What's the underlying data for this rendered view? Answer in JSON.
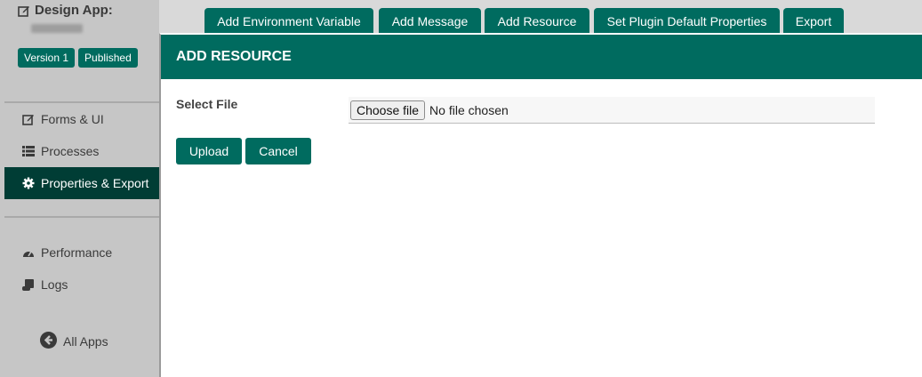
{
  "sidebar": {
    "app_title": "Design App:",
    "badges": [
      "Version 1",
      "Published"
    ],
    "nav_items": [
      {
        "label": "Forms & UI",
        "icon": "edit-icon"
      },
      {
        "label": "Processes",
        "icon": "list-icon"
      },
      {
        "label": "Properties & Export",
        "icon": "gear-icon",
        "active": true
      },
      {
        "label": "Performance",
        "icon": "gauge-icon"
      },
      {
        "label": "Logs",
        "icon": "scroll-icon"
      }
    ],
    "all_apps": "All Apps"
  },
  "tabs": [
    "Add Environment Variable",
    "Add Message",
    "Add Resource",
    "Set Plugin Default Properties",
    "Export"
  ],
  "dialog": {
    "title": "ADD RESOURCE",
    "field_label": "Select File",
    "choose_file": "Choose file",
    "no_file": "No file chosen",
    "upload": "Upload",
    "cancel": "Cancel"
  },
  "colors": {
    "accent": "#006b5f",
    "accent_dark": "#003d35",
    "sidebar_bg": "#c6c6c6"
  }
}
